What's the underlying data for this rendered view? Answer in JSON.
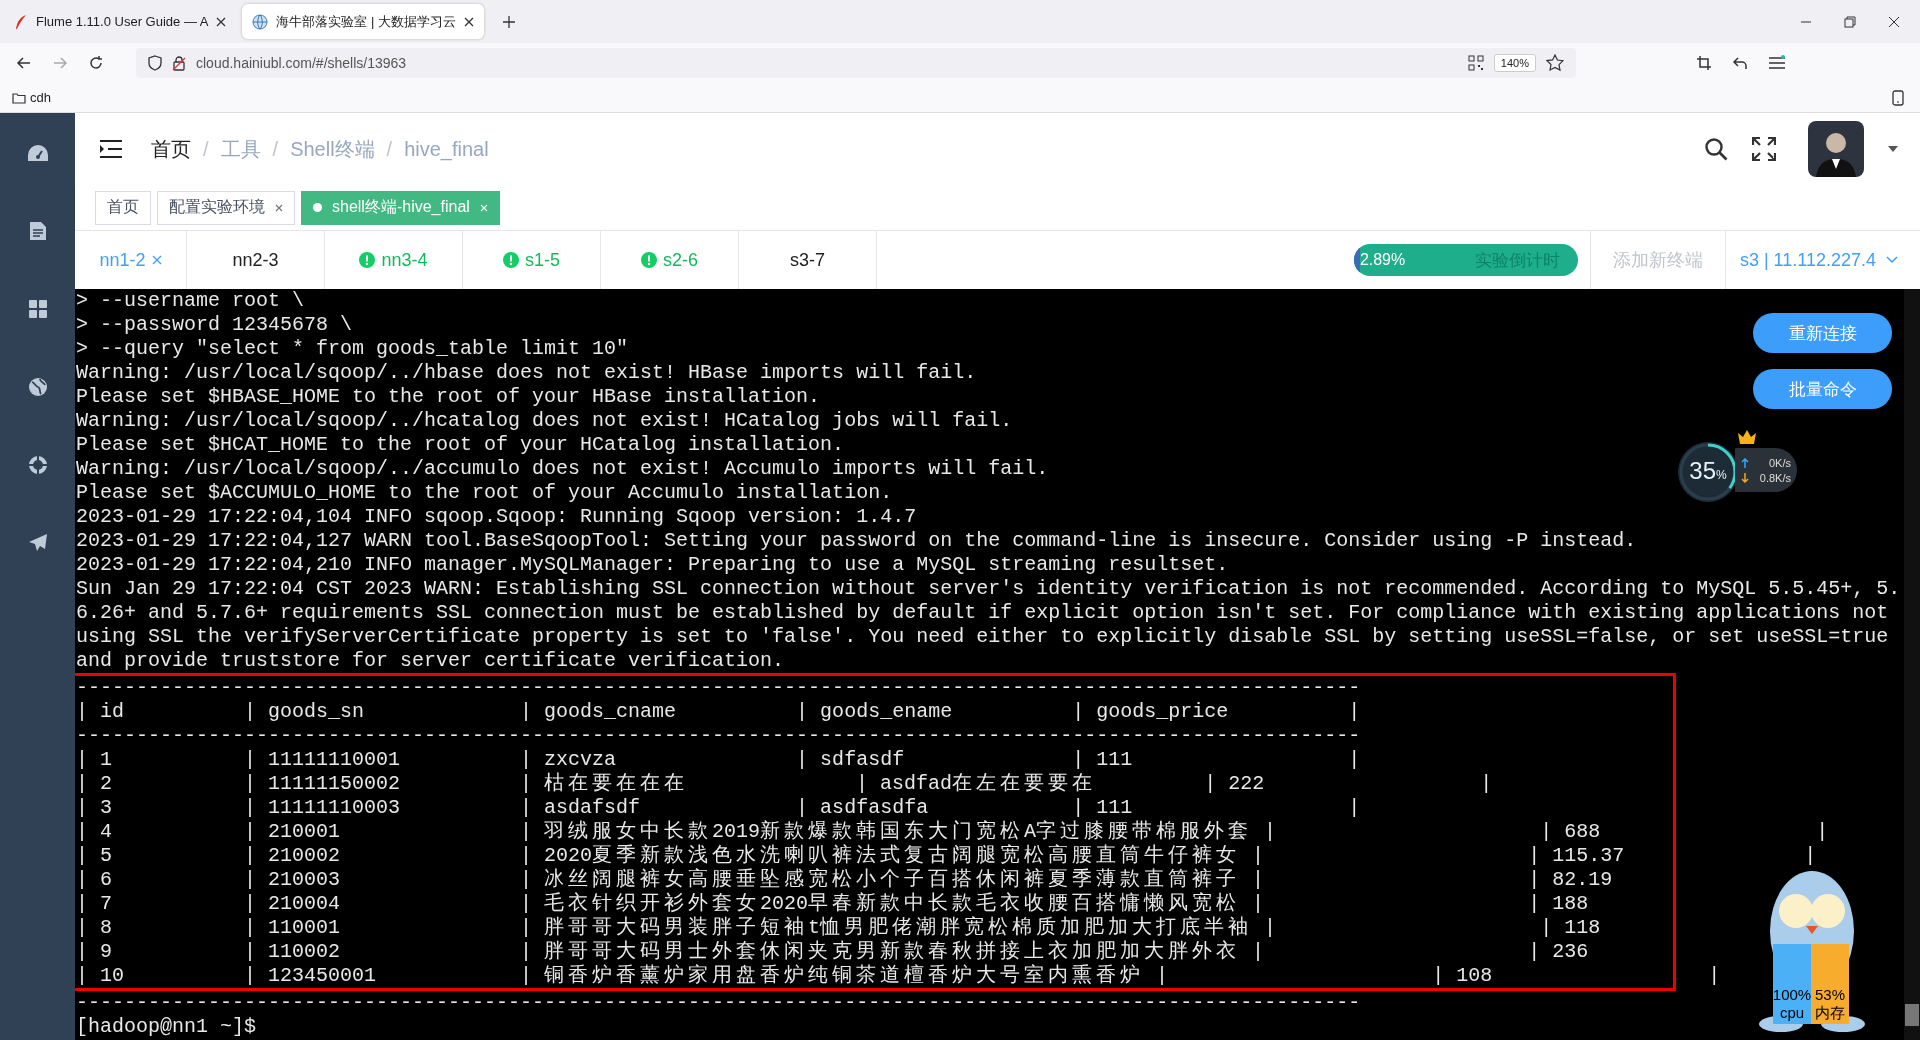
{
  "browser": {
    "tabs": [
      {
        "title": "Flume 1.11.0 User Guide — A",
        "selected": false
      },
      {
        "title": "海牛部落实验室 | 大数据学习云",
        "selected": true
      }
    ],
    "address": "cloud.hainiubl.com/#/shells/13963",
    "zoom": "140%",
    "bookmarks": [
      "cdh"
    ]
  },
  "breadcrumb": [
    "首页",
    "工具",
    "Shell终端",
    "hive_final"
  ],
  "breadcrumb_separator": "/",
  "page_tags": [
    {
      "label": "首页",
      "selected": false,
      "closable": false
    },
    {
      "label": "配置实验环境",
      "selected": false,
      "closable": true
    },
    {
      "label": "shell终端-hive_final",
      "selected": true,
      "closable": true
    }
  ],
  "terminal_tabs": [
    {
      "label": "nn1-2",
      "selected": true,
      "closable": true,
      "kind": "plain"
    },
    {
      "label": "nn2-3",
      "selected": false,
      "closable": false,
      "kind": "plain"
    },
    {
      "label": "nn3-4",
      "selected": false,
      "closable": false,
      "kind": "warning"
    },
    {
      "label": "s1-5",
      "selected": false,
      "closable": false,
      "kind": "warning"
    },
    {
      "label": "s2-6",
      "selected": false,
      "closable": false,
      "kind": "warning"
    },
    {
      "label": "s3-7",
      "selected": false,
      "closable": false,
      "kind": "plain"
    }
  ],
  "timer": {
    "percent": "2.89%",
    "label": "实验倒计时",
    "level": 0.0289
  },
  "add_terminal": "添加新终端",
  "server": "s3 | 11.112.227.4",
  "terminal": {
    "lines": [
      "> --username root \\",
      "> --password 12345678 \\",
      "> --query \"select * from goods_table limit 10\"",
      "Warning: /usr/local/sqoop/../hbase does not exist! HBase imports will fail.",
      "Please set $HBASE_HOME to the root of your HBase installation.",
      "Warning: /usr/local/sqoop/../hcatalog does not exist! HCatalog jobs will fail.",
      "Please set $HCAT_HOME to the root of your HCatalog installation.",
      "Warning: /usr/local/sqoop/../accumulo does not exist! Accumulo imports will fail.",
      "Please set $ACCUMULO_HOME to the root of your Accumulo installation.",
      "2023-01-29 17:22:04,104 INFO sqoop.Sqoop: Running Sqoop version: 1.4.7",
      "2023-01-29 17:22:04,127 WARN tool.BaseSqoopTool: Setting your password on the command-line is insecure. Consider using -P instead.",
      "2023-01-29 17:22:04,210 INFO manager.MySQLManager: Preparing to use a MySQL streaming resultset.",
      "Sun Jan 29 17:22:04 CST 2023 WARN: Establishing SSL connection without server's identity verification is not recommended. According to MySQL 5.5.45+, 5.",
      "6.26+ and 5.7.6+ requirements SSL connection must be established by default if explicit option isn't set. For compliance with existing applications not",
      "using SSL the verifyServerCertificate property is set to 'false'. You need either to explicitly disable SSL by setting useSSL=false, or set useSSL=true",
      "and provide truststore for server certificate verification."
    ],
    "highlighted_lines": [
      "-----------------------------------------------------------------------------------------------------------",
      "| id          | goods_sn             | goods_cname          | goods_ename          | goods_price          |",
      "-----------------------------------------------------------------------------------------------------------",
      "| 1           | 11111110001          | zxcvza               | sdfasdf              | 111                  |",
      "| 2           | 11111150002          | 枯在要在在在              | asdfad在左在要要在         | 222                  |",
      "| 3           | 11111110003          | asdafsdf             | asdfasdfa            | 111                  |",
      "| 4           | 210001               | 羽绒服女中长款2019新款爆款韩国东大门宽松A字过膝腰带棉服外套 |                      | 688                  |",
      "| 5           | 210002               | 2020夏季新款浅色水洗喇叭裤法式复古阔腿宽松高腰直筒牛仔裤女 |                      | 115.37               |",
      "| 6           | 210003               | 冰丝阔腿裤女高腰垂坠感宽松小个子百搭休闲裤夏季薄款直筒裤子 |                      | 82.19",
      "| 7           | 210004               | 毛衣针织开衫外套女2020早春新款中长款毛衣收腰百搭慵懒风宽松 |                      | 188",
      "| 8           | 110001               | 胖哥哥大码男装胖子短袖t恤男肥佬潮胖宽松棉质加肥加大打底半袖 |                      | 118",
      "| 9           | 110002               | 胖哥哥大码男士外套休闲夹克男新款春秋拼接上衣加肥加大胖外衣 |                      | 236",
      "| 10          | 123450001            | 铜香炉香薰炉家用盘香炉纯铜茶道檀香炉大号室内熏香炉 |                      | 108                  |"
    ],
    "lines_after": [
      "-----------------------------------------------------------------------------------------------------------",
      "[hadoop@nn1 ~]$"
    ]
  },
  "actions": [
    "重新连接",
    "批量命令"
  ],
  "net_widget": {
    "percent": "35",
    "unit": "%",
    "level": 0.35,
    "upload": "0K/s",
    "download": "0.8K/s"
  },
  "monitor": {
    "cpu": "100%",
    "memory": "53%",
    "cpu_label": "cpu",
    "memory_label": "内存"
  }
}
